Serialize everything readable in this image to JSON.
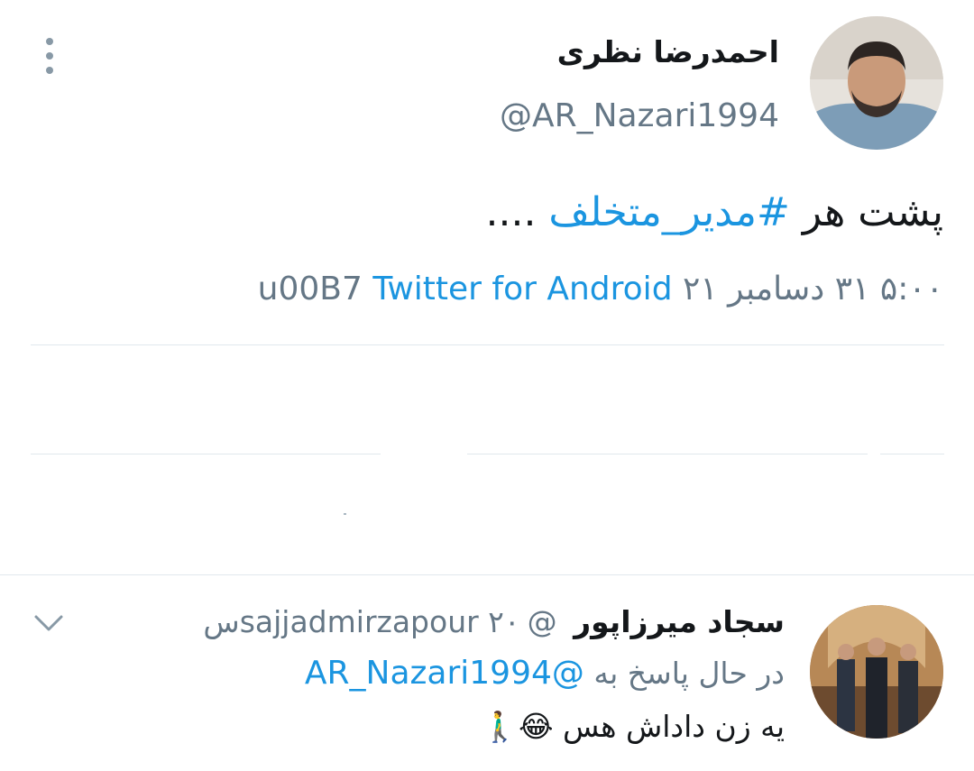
{
  "tweet": {
    "author_name": "احمدرضا نظری",
    "author_handle": "@AR_Nazari1994",
    "text_prefix": "پشت هر ",
    "hashtag": "#مدیر_متخلف",
    "text_suffix": " ....",
    "timestamp": "۵:۰۰ ۳۱ دسامبر ۲۱",
    "separator": "u00B7",
    "source": "Twitter for Android"
  },
  "reply": {
    "author_name": "سجاد میرزاپور",
    "author_handle": "@sajjadmirzapour",
    "time": "۲۰س",
    "replying_label": "در حال پاسخ به",
    "replying_to": "@AR_Nazari1994",
    "text": "یه زن داداش هس 😂🚶‍♂️"
  },
  "icons": {
    "more": "more-vertical-icon",
    "chevron": "chevron-down-icon"
  },
  "colors": {
    "link": "#1b95e0",
    "secondary": "#657786",
    "divider": "#e1e8ed"
  }
}
